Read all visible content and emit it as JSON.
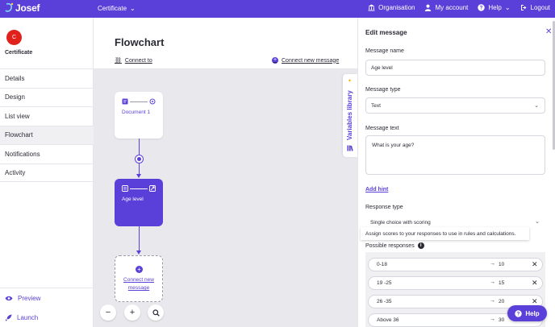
{
  "app": {
    "logo_text": "Josef"
  },
  "topbar": {
    "breadcrumb": "Certificate",
    "nav": [
      "Organisation",
      "My account",
      "Help",
      "Logout"
    ]
  },
  "sidebar": {
    "avatar_initial": "C",
    "project_name": "Certificate",
    "items": [
      "Details",
      "Design",
      "List view",
      "Flowchart",
      "Notifications",
      "Activity"
    ],
    "active": "Flowchart",
    "bottom": [
      "Preview",
      "Launch"
    ]
  },
  "main": {
    "title": "Flowchart",
    "connect_to": "Connect to",
    "connect_new": "Connect new message",
    "nodes": {
      "document": "Document 1",
      "age": "Age level",
      "new_line1": "Connect new",
      "new_line2": "message"
    },
    "zoom": [
      "−",
      "+"
    ]
  },
  "variables_tab": {
    "label": "Variables library"
  },
  "panel": {
    "title": "Edit message",
    "message_name_label": "Message name",
    "message_name_value": "Age level",
    "message_type_label": "Message type",
    "message_type_value": "Text",
    "message_text_label": "Message text",
    "message_text_value": "What is your age?",
    "add_hint": "Add hint",
    "response_type_label": "Response type",
    "response_type_value": "Single choice with scoring",
    "tooltip": "Assign scores to your responses to use in rules and calculations.",
    "possible_responses_label": "Possible responses",
    "responses": [
      {
        "label": "0-18",
        "score": "10"
      },
      {
        "label": "19 -25",
        "score": "15"
      },
      {
        "label": "26 -35",
        "score": "20"
      },
      {
        "label": "Above 36",
        "score": "30"
      }
    ]
  },
  "help_button": "Help",
  "colors": {
    "brand": "#5b3fd9",
    "avatar": "#e0211c",
    "canvas": "#e8e8ed"
  }
}
